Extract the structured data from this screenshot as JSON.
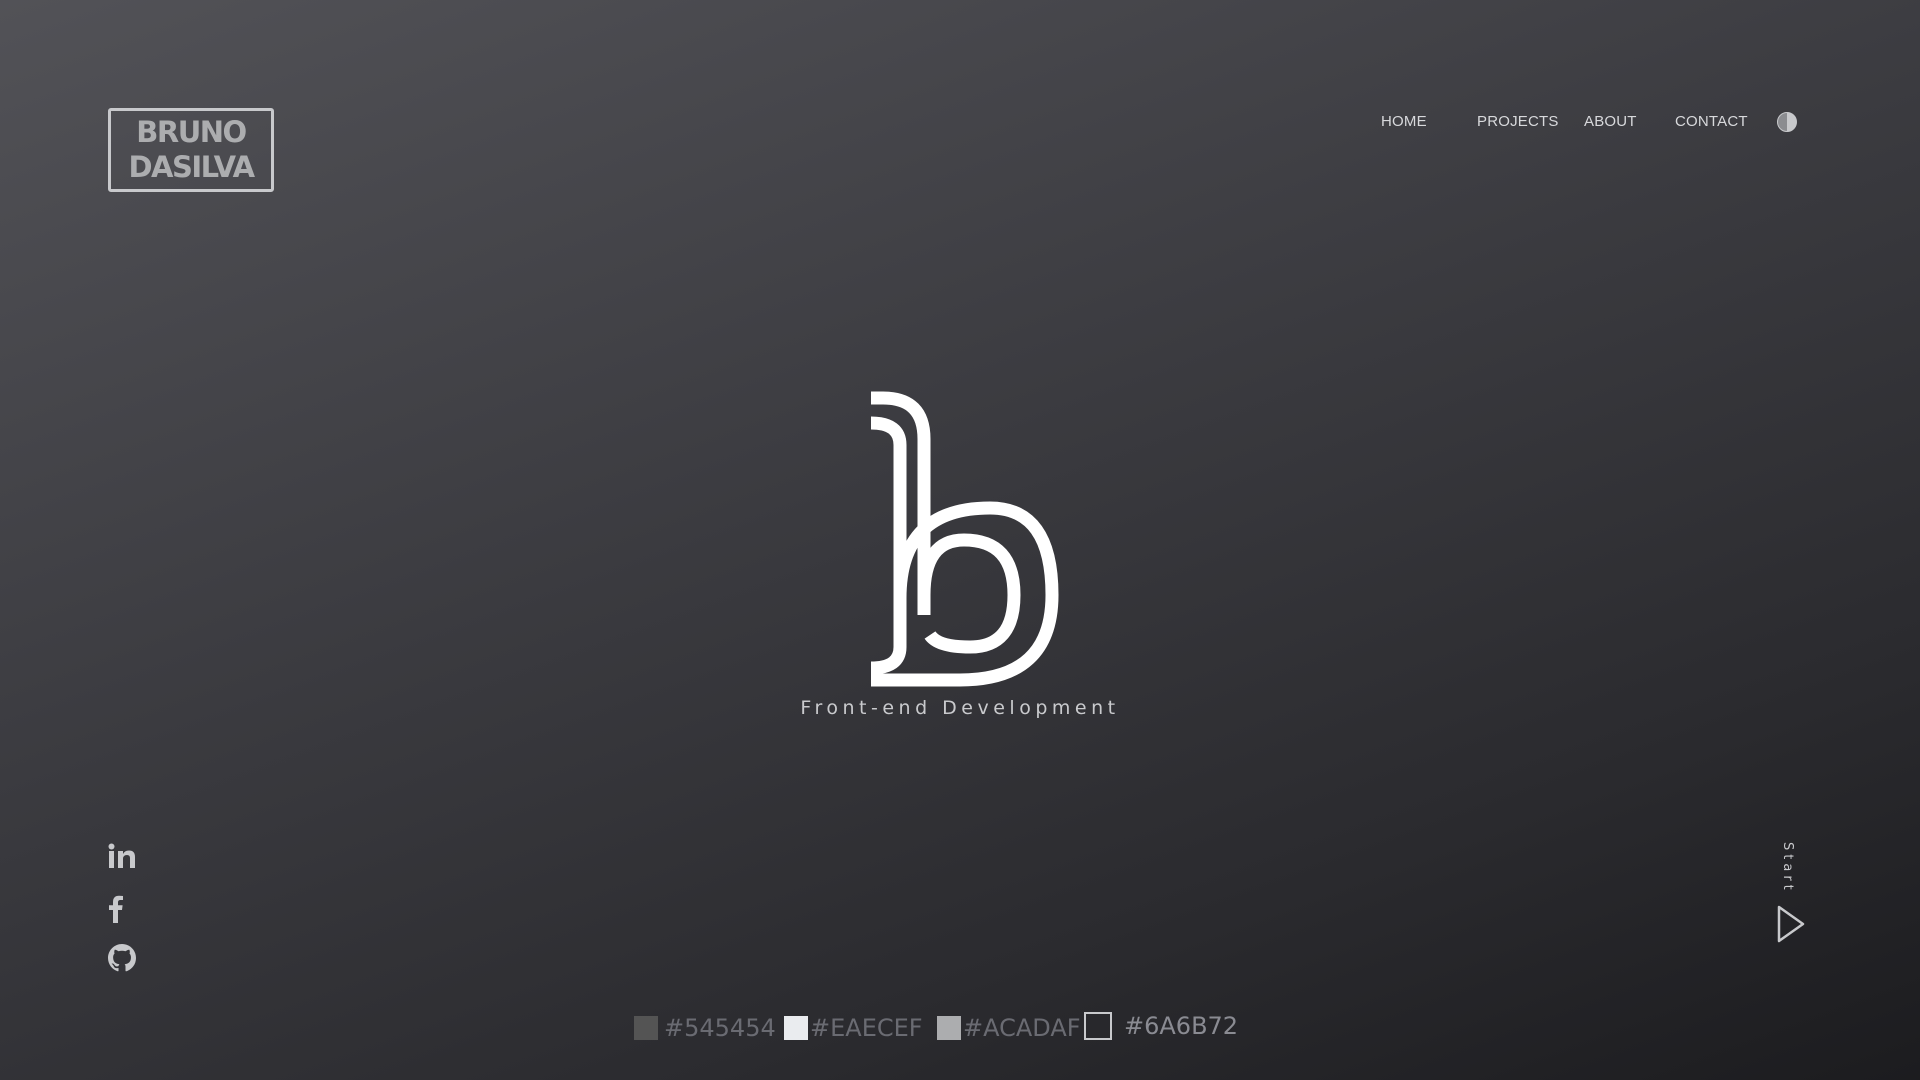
{
  "brand": {
    "line1": "BRUNO",
    "line2": "DASILVA"
  },
  "nav": {
    "items": [
      {
        "label": "HOME"
      },
      {
        "label": "PROJECTS"
      },
      {
        "label": "ABOUT"
      },
      {
        "label": "CONTACT"
      }
    ],
    "theme_toggle_icon": "half-circle-contrast-icon"
  },
  "hero": {
    "logo_icon": "b-monogram-icon",
    "tagline": "Front-end Development"
  },
  "social": [
    {
      "icon": "linkedin-icon"
    },
    {
      "icon": "facebook-icon"
    },
    {
      "icon": "github-icon"
    }
  ],
  "start": {
    "label": "Start",
    "icon": "play-triangle-icon"
  },
  "palette": [
    {
      "label": "#545454",
      "color": "#545454"
    },
    {
      "label": "#EAECEF",
      "color": "#EAECEF"
    },
    {
      "label": "#ACADAF",
      "color": "#ACADAF"
    },
    {
      "label": "#6A6B72",
      "color": "#6A6B72"
    }
  ]
}
